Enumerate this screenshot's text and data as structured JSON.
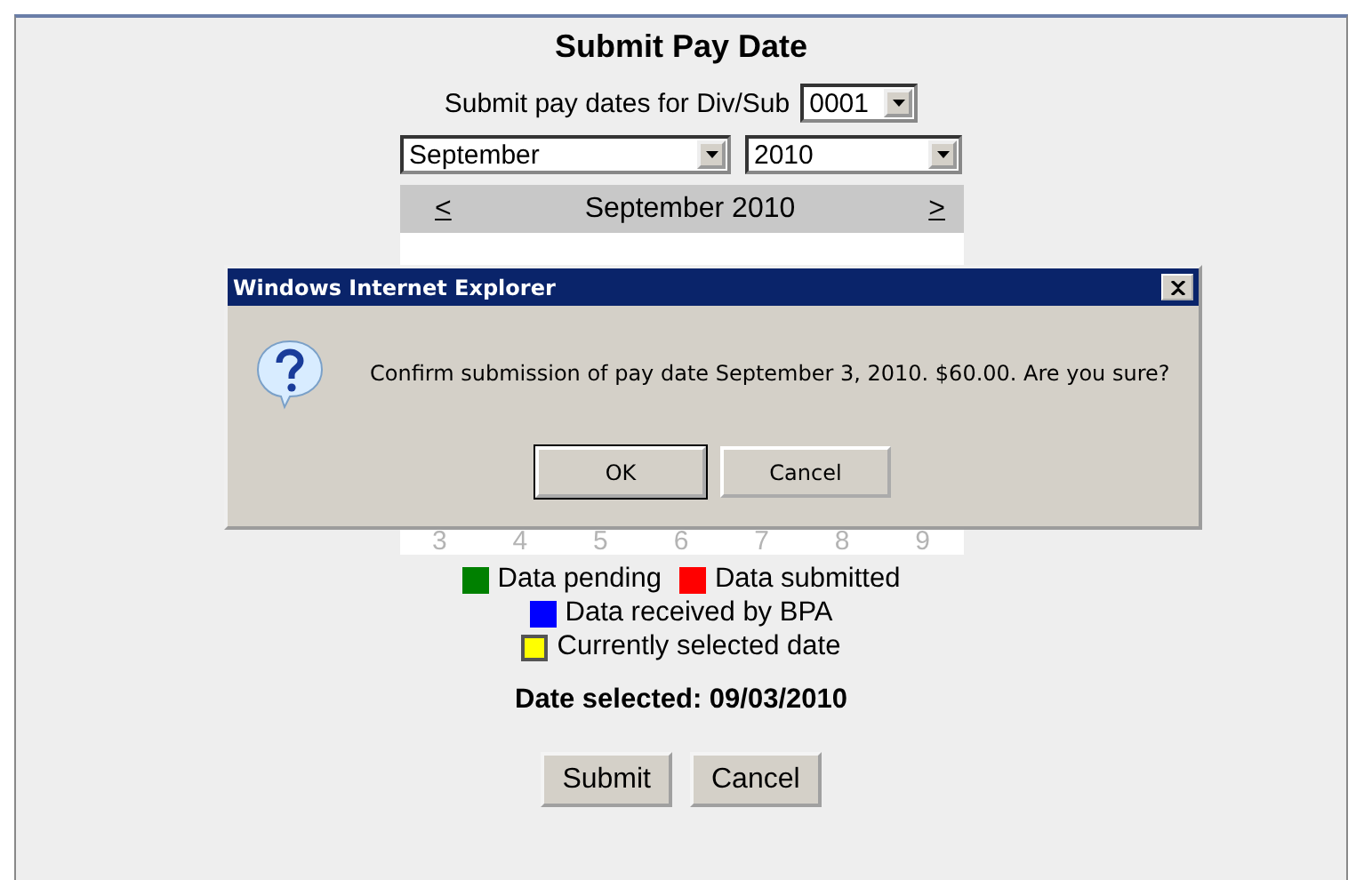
{
  "page": {
    "title": "Submit Pay Date",
    "div_sub_label": "Submit pay dates for Div/Sub",
    "div_sub_value": "0001",
    "month_value": "September",
    "year_value": "2010"
  },
  "calendar": {
    "prev": "<",
    "heading": "September 2010",
    "next": ">",
    "last_week": [
      "3",
      "4",
      "5",
      "6",
      "7",
      "8",
      "9"
    ]
  },
  "legend_rows": [
    {
      "items": [
        {
          "label": "Data pending",
          "color": "#008000",
          "outlined": false
        },
        {
          "label": "Data submitted",
          "color": "#ff0000",
          "outlined": false
        }
      ]
    },
    {
      "items": [
        {
          "label": "Data received by BPA",
          "color": "#0000ff",
          "outlined": false
        }
      ]
    },
    {
      "items": [
        {
          "label": "Currently selected date",
          "color": "#ffff00",
          "outlined": true
        }
      ]
    }
  ],
  "date_selected": "Date selected: 09/03/2010",
  "buttons": [
    "Submit",
    "Cancel"
  ],
  "dialog": {
    "title": "Windows Internet Explorer",
    "message": "Confirm submission of pay date September 3, 2010. $60.00. Are you sure?",
    "buttons": [
      {
        "label": "OK",
        "default": true
      },
      {
        "label": "Cancel",
        "default": false
      }
    ]
  }
}
